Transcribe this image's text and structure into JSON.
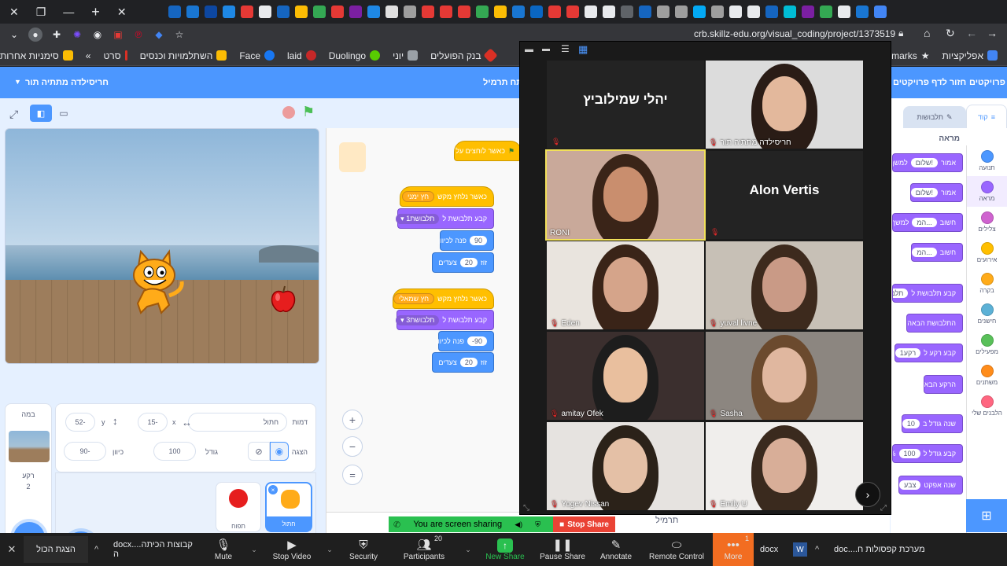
{
  "browser": {
    "url": "crb.skillz-edu.org/visual_coding/project/1373519",
    "bookmarks": [
      {
        "label": "אפליקציות",
        "color": "#4285f4"
      },
      {
        "label": "okmarks",
        "color": "#e8eaed"
      },
      {
        "label": "בנק הפועלים",
        "color": "#d93025"
      },
      {
        "label": "יוני",
        "color": "#9aa0a6"
      },
      {
        "label": "Duolingo",
        "color": "#58cc02"
      },
      {
        "label": "laid",
        "color": "#c62828"
      },
      {
        "label": "Face",
        "color": "#1877f2"
      },
      {
        "label": "השתלמויות וכנסים",
        "color": "#fbbc04"
      },
      {
        "label": "סרט",
        "color": "#d93025"
      },
      {
        "label": "סימניות אחרות",
        "color": "#fbbc04"
      }
    ],
    "bookmarks_more": "»",
    "tab_colors": [
      "#1565c0",
      "#1976d2",
      "#0d47a1",
      "#1e88e5",
      "#e53935",
      "#e8eaed",
      "#1565c0",
      "#fbbc04",
      "#34a853",
      "#e53935",
      "#7b1fa2",
      "#1e88e5",
      "#e0e0e0",
      "#9e9e9e",
      "#e53935",
      "#e53935",
      "#e53935",
      "#34a853",
      "#fbbc04",
      "#1976d2",
      "#0a66c2",
      "#e53935",
      "#e53935",
      "#e8eaed",
      "#e8eaed",
      "#5f6368",
      "#1565c0",
      "#9e9e9e",
      "#9e9e9e",
      "#03a9f4",
      "#9e9e9e",
      "#e8eaed",
      "#e8eaed",
      "#1565c0",
      "#00bcd4",
      "#7b1fa2",
      "#34a853",
      "#e8eaed",
      "#1976d2",
      "#4285f4"
    ]
  },
  "scratch": {
    "menu": {
      "projects": "פרויקטים",
      "back": "חזור לדף פרויקטים",
      "student": "חריסילדה מתתיה תור",
      "student_mid": "פתח תרמיל"
    },
    "tabs": {
      "code": "קוד",
      "costumes": "תלבושות"
    },
    "looks_header": "מראה",
    "categories": [
      {
        "label": "תנועה",
        "color": "#4c97ff"
      },
      {
        "label": "מראה",
        "color": "#9966ff"
      },
      {
        "label": "צלילים",
        "color": "#cf63cf"
      },
      {
        "label": "אירועים",
        "color": "#ffbf00"
      },
      {
        "label": "בקרה",
        "color": "#ffab19"
      },
      {
        "label": "חישנים",
        "color": "#5cb1d6"
      },
      {
        "label": "מפעילים",
        "color": "#59c059"
      },
      {
        "label": "משתנים",
        "color": "#ff8c1a"
      },
      {
        "label": "הלבנים שלי",
        "color": "#ff6680"
      }
    ],
    "palette_blocks": [
      {
        "text": "אמור",
        "input": "שלום!",
        "extra": "למשך"
      },
      {
        "text": "אמור",
        "input": "שלום!",
        "extra": ""
      },
      {
        "text": "חשוב",
        "input": "המ...",
        "extra": "למשך"
      },
      {
        "text": "חשוב",
        "input": "המ...",
        "extra": ""
      },
      {
        "text": "קבע תלבושת ל",
        "input": "תלבוש",
        "extra": ""
      },
      {
        "text": "התלבושת הבאה",
        "input": "",
        "extra": ""
      },
      {
        "text": "קבע רקע ל",
        "input": "רקע1",
        "extra": ""
      },
      {
        "text": "הרקע הבא",
        "input": "",
        "extra": ""
      },
      {
        "text": "שנה גודל ב",
        "input": "10",
        "extra": ""
      },
      {
        "text": "קבע גודל ל",
        "input": "100",
        "extra": "%"
      },
      {
        "text": "שנה אפקט",
        "input": "צבע",
        "extra": ""
      }
    ],
    "scripts": {
      "flag_hat": "כאשר לוחצים על",
      "right_hat": "כאשר נלחץ מקש",
      "right_key": "חץ ימני",
      "costume1_label": "קבע תלבושת ל",
      "costume1": "תלבושת1",
      "turn_label": "פנה לכיוון",
      "dir_right": "90",
      "move_label": "זוז",
      "steps_label": "צעדים",
      "steps": "20",
      "left_hat": "כאשר נלחץ מקש",
      "left_key": "חץ שמאלי",
      "costume3": "תלבושת3",
      "dir_left": "-90",
      "steps2": "20"
    },
    "zoom_symbols": {
      "in": "+",
      "out": "−",
      "reset": "="
    },
    "sprite_info": {
      "sprite_label": "דמות",
      "sprite_name": "חתול",
      "x_label": "x",
      "x_value": "15-",
      "y_label": "y",
      "y_value": "52-",
      "show_label": "הצגה",
      "size_label": "גודל",
      "size_value": "100",
      "direction_label": "כיוון",
      "direction_value": "90-"
    },
    "sprites": [
      {
        "name": "חתול",
        "selected": true
      },
      {
        "name": "תפוח",
        "selected": false
      }
    ],
    "stage_pane": {
      "title": "במה",
      "backdrops_label": "רקע",
      "backdrops_count": "2"
    },
    "backpack": "תרמיל"
  },
  "zoom": {
    "participants": [
      {
        "name": "יהלי שמילוביץ",
        "video": false
      },
      {
        "name": "חריסילדה מתתיה תור",
        "video": true
      },
      {
        "name": "RONI",
        "video": true,
        "active": true
      },
      {
        "name": "Alon Vertis",
        "video": false
      },
      {
        "name": "Eden",
        "video": true
      },
      {
        "name": "yuval livne",
        "video": true
      },
      {
        "name": "amitay Ofek",
        "video": true
      },
      {
        "name": "Sasha",
        "video": true
      },
      {
        "name": "Yogev Nissan",
        "video": true
      },
      {
        "name": "Emily U",
        "video": true
      }
    ],
    "sharing_text": "You are screen sharing",
    "stop_share": "Stop Share",
    "toolbar": {
      "mute": "Mute",
      "stop_video": "Stop Video",
      "security": "Security",
      "participants": "Participants",
      "participants_count": "20",
      "new_share": "New Share",
      "pause_share": "Pause Share",
      "annotate": "Annotate",
      "remote_control": "Remote Control",
      "more": "More",
      "more_badge": "1"
    }
  },
  "taskbar": {
    "show_all": "הצגת הכול",
    "doc1": "docx....קבוצות הכיתה ה",
    "doc2": "docx",
    "doc3": "doc....מערכת קפסולות ח"
  }
}
